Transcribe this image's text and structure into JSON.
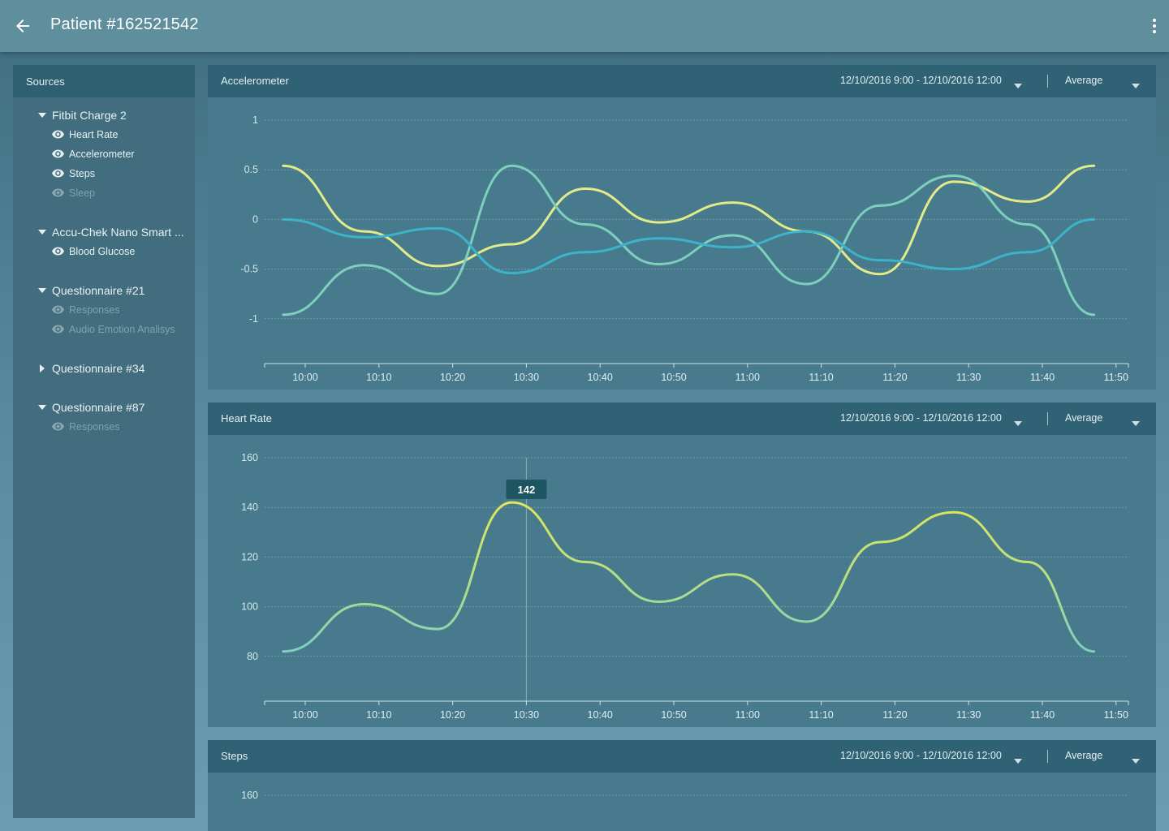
{
  "appbar": {
    "title": "Patient #162521542",
    "back_icon": "arrow-back-icon",
    "menu_icon": "more-vert-icon"
  },
  "sidebar": {
    "header": "Sources",
    "groups": [
      {
        "label": "Fitbit Charge 2",
        "expanded": true,
        "items": [
          {
            "label": "Heart Rate",
            "visible": true
          },
          {
            "label": "Accelerometer",
            "visible": true
          },
          {
            "label": "Steps",
            "visible": true
          },
          {
            "label": "Sleep",
            "visible": false
          }
        ]
      },
      {
        "label": "Accu-Chek Nano Smart ...",
        "expanded": true,
        "items": [
          {
            "label": "Blood Glucose",
            "visible": true
          }
        ]
      },
      {
        "label": "Questionnaire #21",
        "expanded": true,
        "items": [
          {
            "label": "Responses",
            "visible": false
          },
          {
            "label": "Audio Emotion Analisys",
            "visible": false
          }
        ]
      },
      {
        "label": "Questionnaire #34",
        "expanded": false,
        "items": []
      },
      {
        "label": "Questionnaire #87",
        "expanded": true,
        "items": [
          {
            "label": "Responses",
            "visible": false
          }
        ]
      }
    ]
  },
  "panels": [
    {
      "title": "Accelerometer",
      "range": "12/10/2016 9:00 - 12/10/2016 12:00",
      "aggregation": "Average"
    },
    {
      "title": "Heart Rate",
      "range": "12/10/2016 9:00 - 12/10/2016 12:00",
      "aggregation": "Average"
    },
    {
      "title": "Steps",
      "range": "12/10/2016 9:00 - 12/10/2016 12:00",
      "aggregation": "Average"
    }
  ],
  "colors": {
    "line_yellow": "#e3ea8a",
    "line_teal": "#7ecfbd",
    "line_blue": "#3db3c9",
    "line_hr_hot": "#dfe65a",
    "tooltip_bg": "#1d5563"
  },
  "chart_data": [
    {
      "type": "line",
      "title": "Accelerometer",
      "x": [
        "9:57",
        "10:08",
        "10:18",
        "10:28",
        "10:38",
        "10:48",
        "10:58",
        "11:08",
        "11:18",
        "11:28",
        "11:38",
        "11:47"
      ],
      "x_ticks": [
        "10:00",
        "10:10",
        "10:20",
        "10:30",
        "10:40",
        "10:50",
        "11:00",
        "11:10",
        "11:20",
        "11:30",
        "11:40",
        "11:50"
      ],
      "y_ticks": [
        "1",
        "0.5",
        "0",
        "-0.5",
        "-1"
      ],
      "ylim": [
        -1,
        1
      ],
      "grid": true,
      "series": [
        {
          "color": "#e3ea8a",
          "values": [
            0.54,
            -0.12,
            -0.47,
            -0.25,
            0.31,
            -0.03,
            0.17,
            -0.12,
            -0.55,
            0.38,
            0.18,
            0.54
          ]
        },
        {
          "color": "#7ecfbd",
          "values": [
            -0.96,
            -0.46,
            -0.75,
            0.54,
            -0.05,
            -0.45,
            -0.16,
            -0.65,
            0.14,
            0.44,
            -0.05,
            -0.96
          ]
        },
        {
          "color": "#3db3c9",
          "values": [
            0.0,
            -0.18,
            -0.09,
            -0.54,
            -0.33,
            -0.19,
            -0.28,
            -0.12,
            -0.41,
            -0.5,
            -0.33,
            0.0
          ]
        }
      ]
    },
    {
      "type": "line",
      "title": "Heart Rate",
      "x": [
        "9:57",
        "10:08",
        "10:18",
        "10:28",
        "10:38",
        "10:48",
        "10:58",
        "11:08",
        "11:18",
        "11:28",
        "11:38",
        "11:47"
      ],
      "x_ticks": [
        "10:00",
        "10:10",
        "10:20",
        "10:30",
        "10:40",
        "10:50",
        "11:00",
        "11:10",
        "11:20",
        "11:30",
        "11:40",
        "11:50"
      ],
      "y_ticks": [
        "160",
        "140",
        "120",
        "100",
        "80"
      ],
      "ylim": [
        80,
        160
      ],
      "grid": true,
      "tooltip": {
        "x": "10:30",
        "label": "142"
      },
      "series": [
        {
          "color": "#7ecfbd",
          "values": [
            82,
            101,
            91,
            142,
            118,
            102,
            113,
            94,
            126,
            138,
            118,
            82
          ]
        }
      ]
    },
    {
      "type": "line",
      "title": "Steps",
      "y_ticks": [
        "160"
      ],
      "grid": true,
      "series": []
    }
  ]
}
